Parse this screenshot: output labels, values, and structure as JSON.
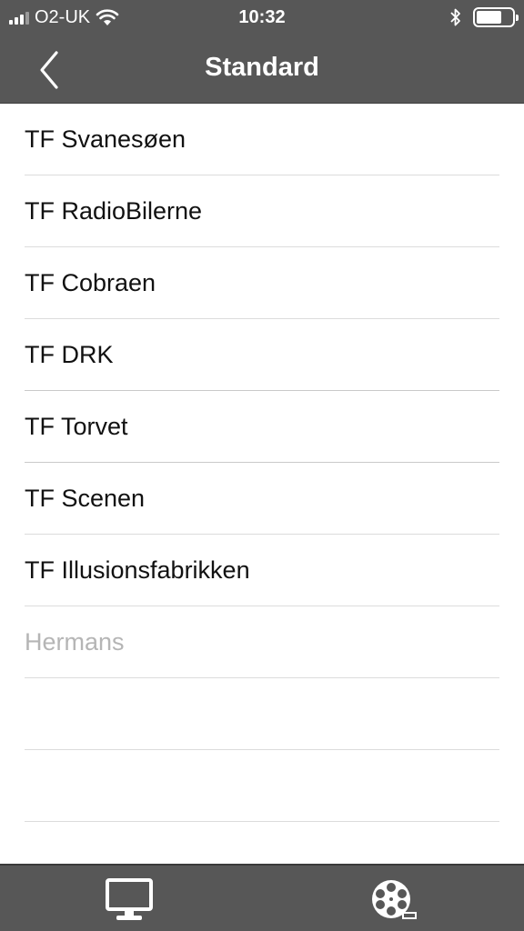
{
  "status_bar": {
    "carrier": "O2-UK",
    "time": "10:32",
    "signal_bars_filled": 3,
    "signal_bars_total": 4,
    "battery_level": 0.7,
    "icons": [
      "signal-icon",
      "wifi-icon",
      "bluetooth-icon",
      "battery-icon"
    ]
  },
  "nav": {
    "title": "Standard",
    "back_icon": "chevron-left-icon"
  },
  "list": {
    "items": [
      {
        "label": "TF Svanesøen"
      },
      {
        "label": "TF RadioBilerne"
      },
      {
        "label": "TF Cobraen"
      },
      {
        "label": "TF DRK"
      },
      {
        "label": "TF Torvet"
      },
      {
        "label": "TF Scenen"
      },
      {
        "label": "TF Illusionsfabrikken"
      },
      {
        "label": "Hermans",
        "dimmed": true
      },
      {
        "label": ""
      },
      {
        "label": ""
      }
    ]
  },
  "tab_bar": {
    "tabs": [
      {
        "icon": "monitor-icon"
      },
      {
        "icon": "film-reel-icon"
      }
    ]
  },
  "colors": {
    "bar_background": "#575757",
    "text_primary": "#111111",
    "text_dimmed": "#b5b5b5",
    "separator": "#dcdcdc"
  }
}
